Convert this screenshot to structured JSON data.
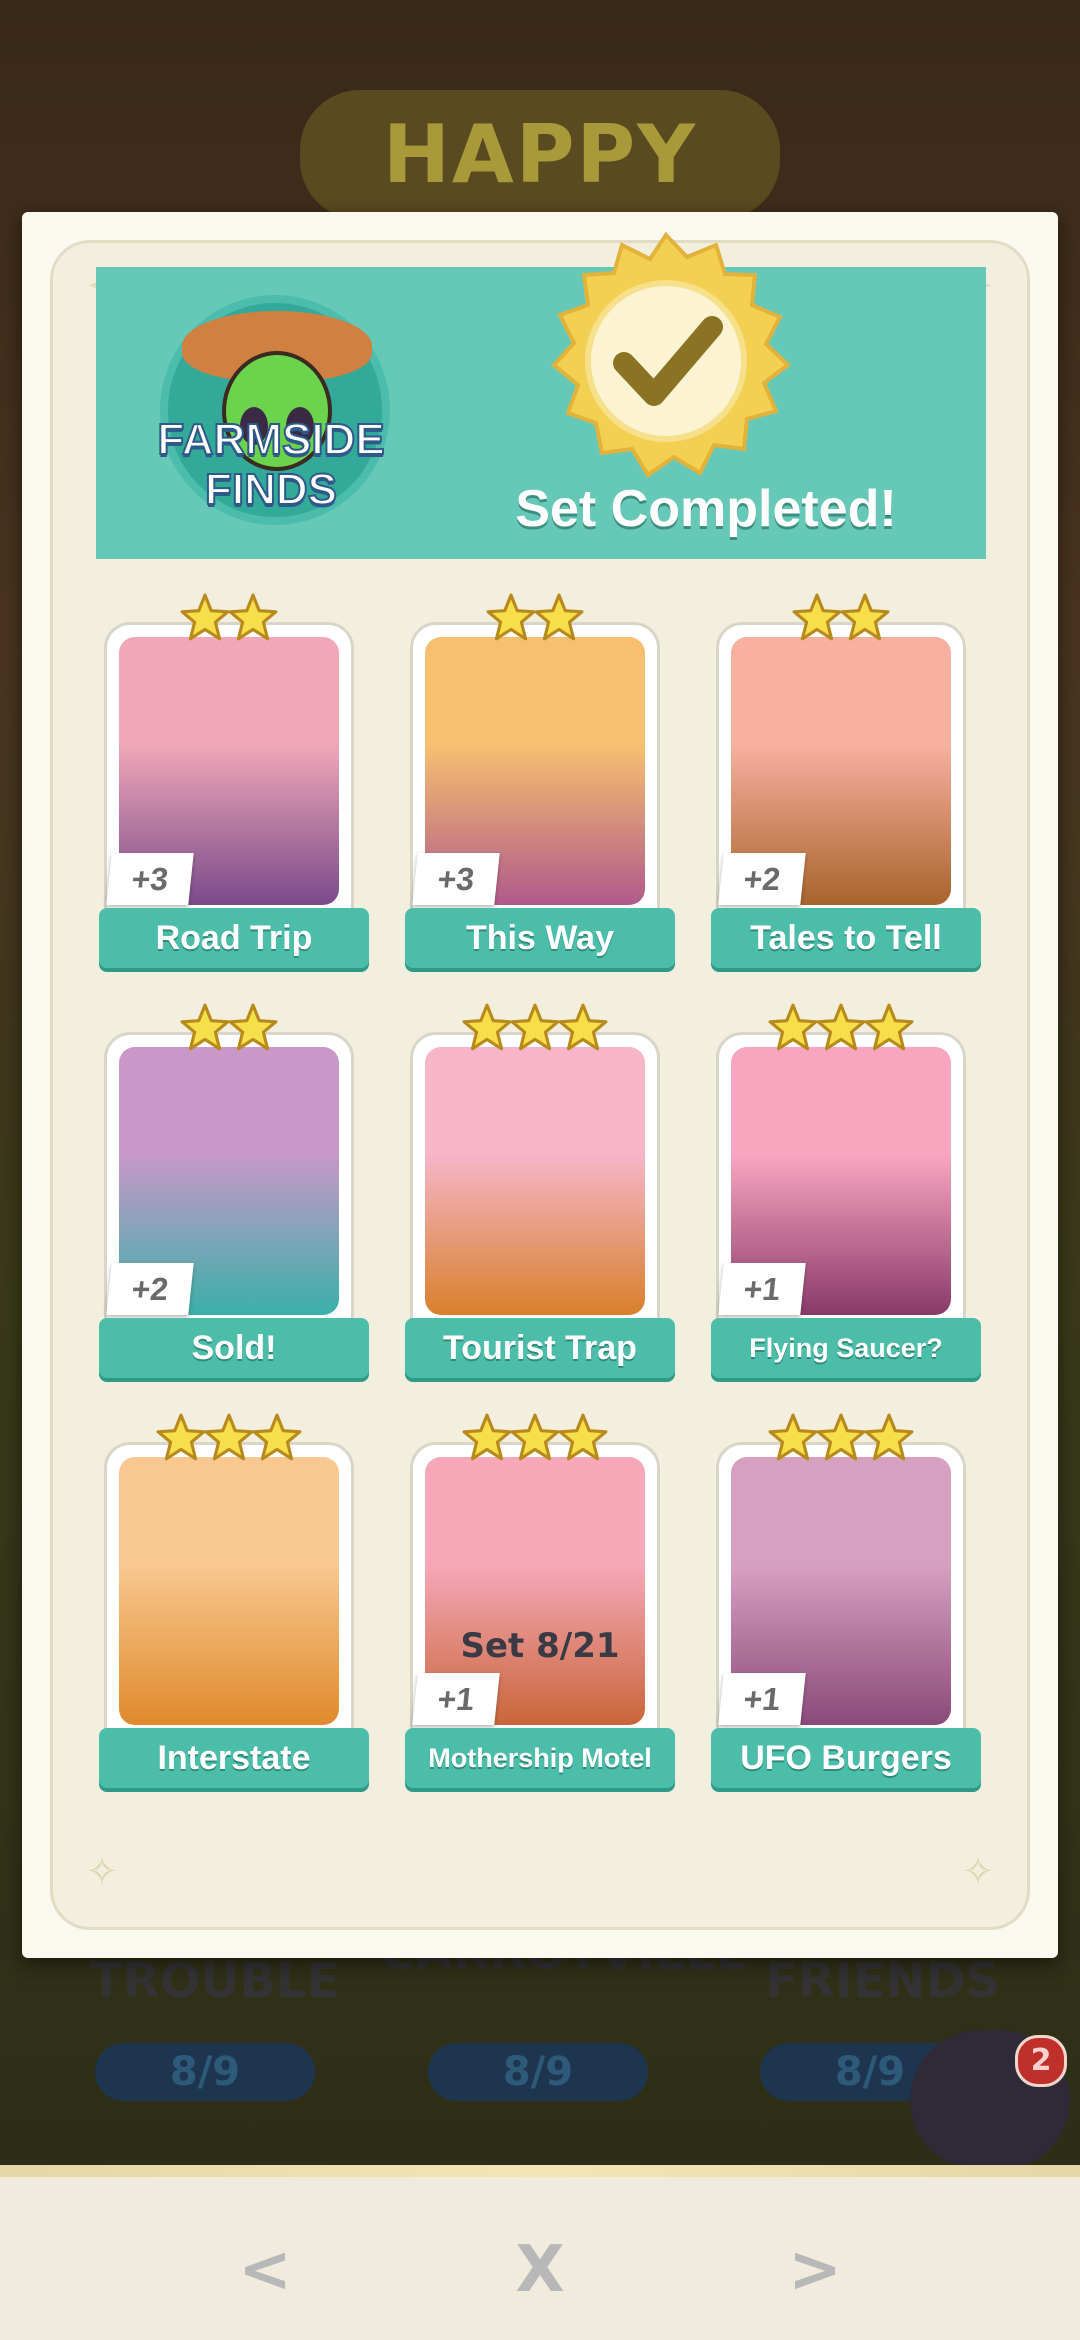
{
  "background": {
    "banner_text": "HAPPY",
    "sets": [
      {
        "label": "TROUBLE",
        "progress": "8/9"
      },
      {
        "label": "CARROTVILLE",
        "progress": "8/9"
      },
      {
        "label": "FRIENDS",
        "progress": "8/9"
      }
    ],
    "notification_count": "2"
  },
  "set": {
    "logo_line1": "FARMSIDE",
    "logo_line2": "FINDS",
    "status": "Set Completed!",
    "counter": "Set 8/21"
  },
  "cards": [
    {
      "name": "Road Trip",
      "stars": 2,
      "badge": "+3",
      "theme": [
        "#f0a8b8",
        "#7a4a8a"
      ]
    },
    {
      "name": "This Way",
      "stars": 2,
      "badge": "+3",
      "theme": [
        "#f7c070",
        "#b05a8a"
      ]
    },
    {
      "name": "Tales to Tell",
      "stars": 2,
      "badge": "+2",
      "theme": [
        "#f8b0a0",
        "#a8642c"
      ]
    },
    {
      "name": "Sold!",
      "stars": 2,
      "badge": "+2",
      "theme": [
        "#c898c8",
        "#3ab0a8"
      ]
    },
    {
      "name": "Tourist Trap",
      "stars": 3,
      "badge": "",
      "theme": [
        "#f6b6c8",
        "#d8802c"
      ]
    },
    {
      "name": "Flying Saucer?",
      "stars": 3,
      "badge": "+1",
      "theme": [
        "#f8a6c0",
        "#8a3a6a"
      ]
    },
    {
      "name": "Interstate",
      "stars": 3,
      "badge": "",
      "theme": [
        "#f8c890",
        "#e08a2c"
      ]
    },
    {
      "name": "Mothership Motel",
      "stars": 3,
      "badge": "+1",
      "theme": [
        "#f6a8b8",
        "#c8663a"
      ]
    },
    {
      "name": "UFO Burgers",
      "stars": 3,
      "badge": "+1",
      "theme": [
        "#d8a0c0",
        "#8a4a7a"
      ]
    }
  ],
  "nav": {
    "prev": "<",
    "close": "X",
    "next": ">"
  },
  "colors": {
    "teal": "#4bbda9",
    "header": "#66c9b7",
    "gold": "#f4c842",
    "card": "#fbf8f0"
  }
}
